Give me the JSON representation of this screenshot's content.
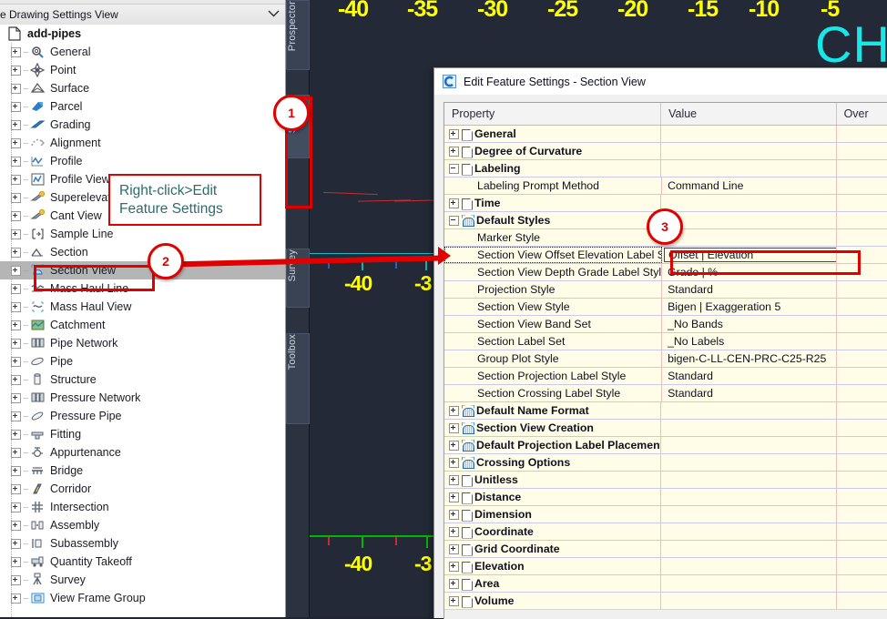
{
  "cad": {
    "top_ticks": [
      "-40",
      "-35",
      "-30",
      "-25",
      "-20",
      "-15",
      "-10",
      "-5"
    ],
    "mid_ticks": [
      "-40",
      "-3"
    ],
    "bottom_ticks": [
      "-40",
      "-3"
    ],
    "watermark": "CH",
    "tick_color": "#ffff00",
    "watermark_color": "#18e7e7",
    "background_color": "#232936"
  },
  "palette_tabs": [
    {
      "label": "Prospector",
      "active": false
    },
    {
      "label": "Settings",
      "active": true
    },
    {
      "label": "Survey",
      "active": false
    },
    {
      "label": "Toolbox",
      "active": false
    }
  ],
  "settings_panel": {
    "drawing_selector": {
      "label": "re Drawing Settings View",
      "caret_icon": "chevron-down-icon"
    },
    "root": {
      "label": "add-pipes",
      "icon": "drawing-icon"
    },
    "items": [
      {
        "label": "General",
        "icon": "gear-icon"
      },
      {
        "label": "Point",
        "icon": "point-icon"
      },
      {
        "label": "Surface",
        "icon": "surface-icon"
      },
      {
        "label": "Parcel",
        "icon": "parcel-icon"
      },
      {
        "label": "Grading",
        "icon": "grading-icon"
      },
      {
        "label": "Alignment",
        "icon": "alignment-icon"
      },
      {
        "label": "Profile",
        "icon": "profile-icon"
      },
      {
        "label": "Profile View",
        "icon": "profile-view-icon"
      },
      {
        "label": "Superelevation",
        "icon": "superelevation-icon"
      },
      {
        "label": "Cant View",
        "icon": "cant-view-icon"
      },
      {
        "label": "Sample Line",
        "icon": "sample-line-icon"
      },
      {
        "label": "Section",
        "icon": "section-icon"
      },
      {
        "label": "Section View",
        "icon": "section-view-icon",
        "selected": true
      },
      {
        "label": "Mass Haul Line",
        "icon": "mass-haul-line-icon"
      },
      {
        "label": "Mass Haul View",
        "icon": "mass-haul-view-icon"
      },
      {
        "label": "Catchment",
        "icon": "catchment-icon"
      },
      {
        "label": "Pipe Network",
        "icon": "pipe-network-icon"
      },
      {
        "label": "Pipe",
        "icon": "pipe-icon"
      },
      {
        "label": "Structure",
        "icon": "structure-icon"
      },
      {
        "label": "Pressure Network",
        "icon": "pressure-network-icon"
      },
      {
        "label": "Pressure Pipe",
        "icon": "pressure-pipe-icon"
      },
      {
        "label": "Fitting",
        "icon": "fitting-icon"
      },
      {
        "label": "Appurtenance",
        "icon": "appurtenance-icon"
      },
      {
        "label": "Bridge",
        "icon": "bridge-icon"
      },
      {
        "label": "Corridor",
        "icon": "corridor-icon"
      },
      {
        "label": "Intersection",
        "icon": "intersection-icon"
      },
      {
        "label": "Assembly",
        "icon": "assembly-icon"
      },
      {
        "label": "Subassembly",
        "icon": "subassembly-icon"
      },
      {
        "label": "Quantity Takeoff",
        "icon": "quantity-takeoff-icon"
      },
      {
        "label": "Survey",
        "icon": "survey-icon"
      },
      {
        "label": "View Frame Group",
        "icon": "view-frame-group-icon"
      }
    ]
  },
  "dialog": {
    "title": "Edit Feature Settings - Section View",
    "icon": "civil3d-icon",
    "columns": [
      "Property",
      "Value",
      "Over"
    ],
    "rows": [
      {
        "property": "General",
        "value": "",
        "type": "category",
        "icon": "doc-icon",
        "state": "collapsed"
      },
      {
        "property": "Degree of Curvature",
        "value": "",
        "type": "category",
        "icon": "doc-icon",
        "state": "collapsed"
      },
      {
        "property": "Labeling",
        "value": "",
        "type": "category",
        "icon": "doc-icon",
        "state": "expanded"
      },
      {
        "property": "Labeling Prompt Method",
        "value": "Command Line",
        "type": "child"
      },
      {
        "property": "Time",
        "value": "",
        "type": "category",
        "icon": "doc-icon",
        "state": "collapsed"
      },
      {
        "property": "Default Styles",
        "value": "",
        "type": "category",
        "icon": "sv-icon",
        "state": "expanded"
      },
      {
        "property": "Marker Style",
        "value": "",
        "type": "child"
      },
      {
        "property": "Section View Offset Elevation Label St...",
        "value": "Offset | Elevation",
        "type": "child",
        "highlighted": true
      },
      {
        "property": "Section View Depth Grade Label Style",
        "value": "Grade | %",
        "type": "child"
      },
      {
        "property": "Projection Style",
        "value": "Standard",
        "type": "child"
      },
      {
        "property": "Section View Style",
        "value": "Bigen | Exaggeration 5",
        "type": "child"
      },
      {
        "property": "Section View Band Set",
        "value": "_No Bands",
        "type": "child"
      },
      {
        "property": "Section Label Set",
        "value": "_No Labels",
        "type": "child"
      },
      {
        "property": "Group Plot Style",
        "value": "bigen-C-LL-CEN-PRC-C25-R25",
        "type": "child"
      },
      {
        "property": "Section Projection Label Style",
        "value": "Standard",
        "type": "child"
      },
      {
        "property": "Section Crossing Label Style",
        "value": "Standard",
        "type": "child"
      },
      {
        "property": "Default Name Format",
        "value": "",
        "type": "category",
        "icon": "sv-icon",
        "state": "collapsed"
      },
      {
        "property": "Section View Creation",
        "value": "",
        "type": "category",
        "icon": "sv-icon",
        "state": "collapsed"
      },
      {
        "property": "Default Projection Label Placement",
        "value": "",
        "type": "category",
        "icon": "sv-icon",
        "state": "collapsed"
      },
      {
        "property": "Crossing Options",
        "value": "",
        "type": "category",
        "icon": "sv-icon",
        "state": "collapsed"
      },
      {
        "property": "Unitless",
        "value": "",
        "type": "category",
        "icon": "doc-icon",
        "state": "collapsed"
      },
      {
        "property": "Distance",
        "value": "",
        "type": "category",
        "icon": "doc-icon",
        "state": "collapsed"
      },
      {
        "property": "Dimension",
        "value": "",
        "type": "category",
        "icon": "doc-icon",
        "state": "collapsed"
      },
      {
        "property": "Coordinate",
        "value": "",
        "type": "category",
        "icon": "doc-icon",
        "state": "collapsed"
      },
      {
        "property": "Grid Coordinate",
        "value": "",
        "type": "category",
        "icon": "doc-icon",
        "state": "collapsed"
      },
      {
        "property": "Elevation",
        "value": "",
        "type": "category",
        "icon": "doc-icon",
        "state": "collapsed"
      },
      {
        "property": "Area",
        "value": "",
        "type": "category",
        "icon": "doc-icon",
        "state": "collapsed"
      },
      {
        "property": "Volume",
        "value": "",
        "type": "category",
        "icon": "doc-icon",
        "state": "collapsed"
      }
    ]
  },
  "annotations": {
    "callout_lines": [
      "Right-click>Edit",
      "Feature Settings"
    ],
    "callout_color": "#2e6b6b",
    "marker_color": "#e00000",
    "badges": [
      "1",
      "2",
      "3"
    ]
  }
}
